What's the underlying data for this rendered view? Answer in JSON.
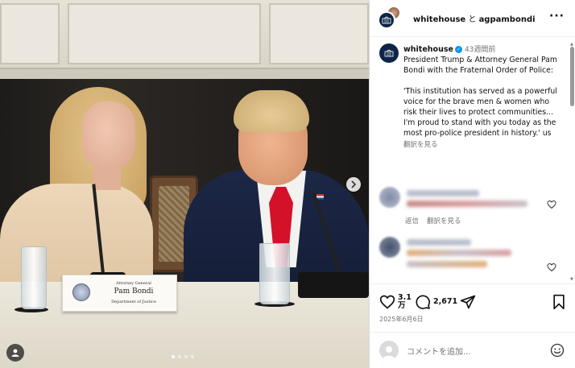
{
  "post_image": {
    "nameplate": {
      "title_line": "Attorney General",
      "name": "Pam Bondi",
      "dept_line": "Department of Justice"
    },
    "carousel": {
      "total": 4,
      "active_index": 0
    }
  },
  "header": {
    "account1": "whitehouse",
    "connector": " と ",
    "account2": "agpambondi"
  },
  "caption": {
    "username": "whitehouse",
    "time": "43週間前",
    "text": "President Trump & Attorney General Pam Bondi with the Fraternal Order of Police:\n\n'This institution has served as a powerful voice for the brave men & women who risk their lives to protect communities... I'm proud to stand with you today as the most pro-police president in history.' us",
    "translate": "翻訳を見る"
  },
  "comments": [
    {
      "reply": "返信",
      "translate": "翻訳を見る"
    },
    {
      "reply": "",
      "translate": ""
    }
  ],
  "actions": {
    "likes": "3.1",
    "likes_unit": "万",
    "comments": "2,671"
  },
  "date": "2025年6月6日",
  "add_comment": {
    "placeholder": "コメントを追加..."
  },
  "colors": {
    "verified": "#0095f6",
    "tie": "#d3122a",
    "suit": "#1c2746"
  }
}
